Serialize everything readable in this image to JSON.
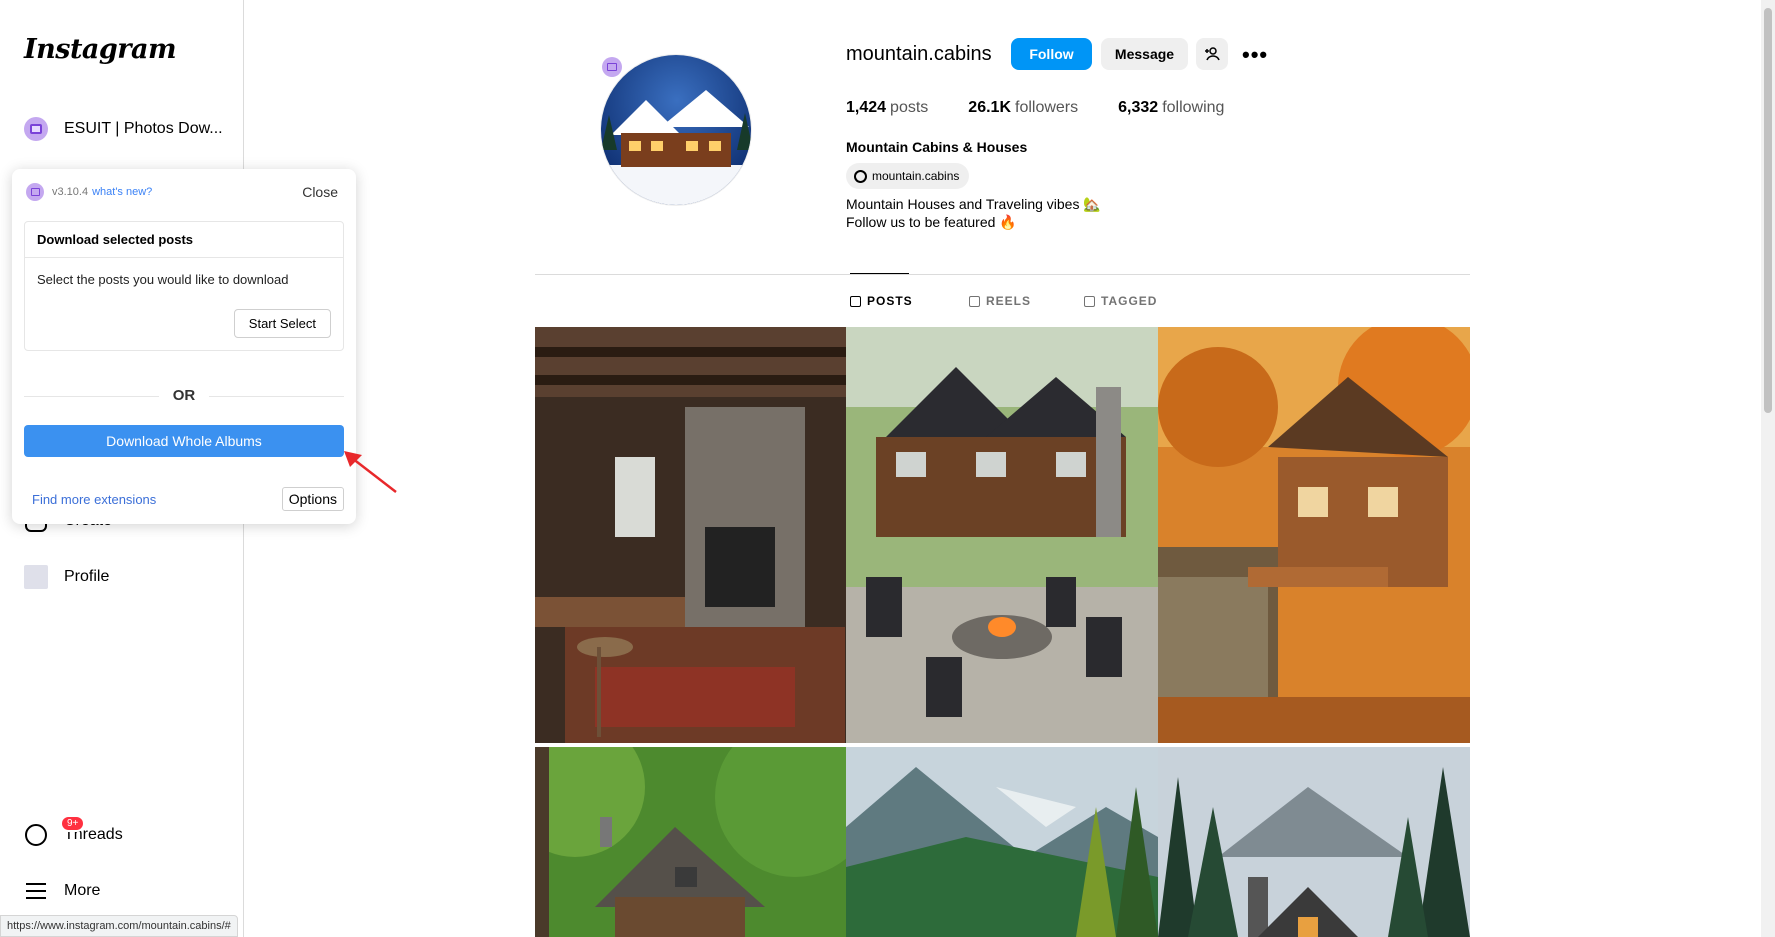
{
  "sidebar": {
    "logo": "Instagram",
    "ext_label": "ESUIT | Photos Dow...",
    "items": [
      {
        "label": "Create"
      },
      {
        "label": "Profile"
      },
      {
        "label": "Threads",
        "badge": "9+"
      },
      {
        "label": "More"
      }
    ]
  },
  "popup": {
    "version": "v3.10.4",
    "whats_new": "what's new?",
    "close": "Close",
    "card_title": "Download selected posts",
    "card_desc": "Select the posts you would like to download",
    "start_select": "Start Select",
    "or": "OR",
    "download_whole": "Download Whole Albums",
    "find_more": "Find more extensions",
    "options": "Options"
  },
  "profile": {
    "username": "mountain.cabins",
    "follow": "Follow",
    "message": "Message",
    "posts_count": "1,424",
    "posts_label": "posts",
    "followers_count": "26.1K",
    "followers_label": "followers",
    "following_count": "6,332",
    "following_label": "following",
    "full_name": "Mountain Cabins & Houses",
    "threads_handle": "mountain.cabins",
    "bio_line1": "Mountain Houses and Traveling vibes 🏡",
    "bio_line2": "Follow us to be featured 🔥"
  },
  "tabs": [
    {
      "label": "POSTS",
      "icon": "grid-icon",
      "active": true
    },
    {
      "label": "REELS",
      "icon": "reels-icon",
      "active": false
    },
    {
      "label": "TAGGED",
      "icon": "tagged-icon",
      "active": false
    }
  ],
  "posts": [
    {
      "subject": "rustic stone kitchen",
      "icon": "image-icon"
    },
    {
      "subject": "log house with fire pit",
      "icon": "image-icon"
    },
    {
      "subject": "lakeside cabin autumn",
      "icon": "image-icon"
    },
    {
      "subject": "forest cabin",
      "icon": "image-icon"
    },
    {
      "subject": "mountain valley",
      "icon": "image-icon"
    },
    {
      "subject": "cabin among pines",
      "icon": "image-icon"
    }
  ],
  "status_url": "https://www.instagram.com/mountain.cabins/#",
  "colors": {
    "follow": "#0095f6",
    "download": "#3b91f0",
    "link": "#3b6fd8"
  }
}
